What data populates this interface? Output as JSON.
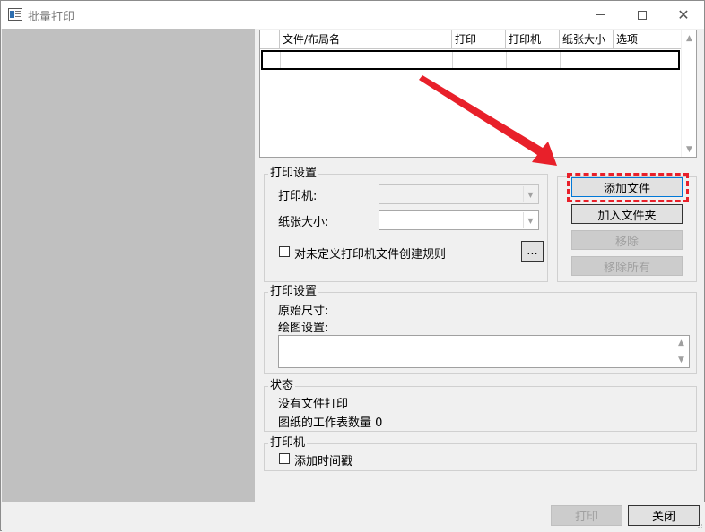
{
  "window": {
    "title": "批量打印"
  },
  "file_list": {
    "columns": [
      "文件/布局名",
      "打印",
      "打印机",
      "纸张大小",
      "选项"
    ]
  },
  "print_settings": {
    "legend": "打印设置",
    "printer_label": "打印机:",
    "paper_label": "纸张大小:",
    "rule_checkbox_label": "对未定义打印机文件创建规则",
    "ellipsis_label": "..."
  },
  "file_buttons": {
    "add_file": "添加文件",
    "add_folder": "加入文件夹",
    "remove": "移除",
    "remove_all": "移除所有"
  },
  "plot_settings": {
    "legend": "打印设置",
    "original_size_label": "原始尺寸:",
    "plot_setup_label": "绘图设置:"
  },
  "status": {
    "legend": "状态",
    "message": "没有文件打印",
    "sheet_count": "图纸的工作表数量 0"
  },
  "printer_group": {
    "legend": "打印机",
    "timestamp_label": "添加时间戳"
  },
  "footer": {
    "print_button": "打印",
    "close_button": "关闭"
  },
  "annotation": {
    "color": "#e8202a"
  }
}
